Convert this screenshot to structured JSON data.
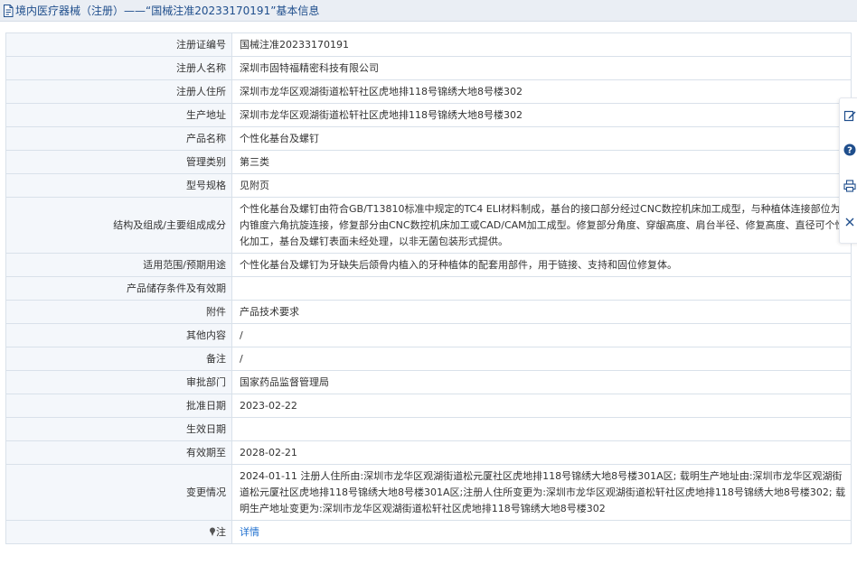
{
  "header": {
    "title": "境内医疗器械（注册）——“国械注准20233170191”基本信息"
  },
  "rows": [
    {
      "label": "注册证编号",
      "value": "国械注准20233170191"
    },
    {
      "label": "注册人名称",
      "value": "深圳市固特福精密科技有限公司"
    },
    {
      "label": "注册人住所",
      "value": "深圳市龙华区观湖街道松轩社区虎地排118号锦绣大地8号楼302"
    },
    {
      "label": "生产地址",
      "value": "深圳市龙华区观湖街道松轩社区虎地排118号锦绣大地8号楼302"
    },
    {
      "label": "产品名称",
      "value": "个性化基台及螺钉"
    },
    {
      "label": "管理类别",
      "value": "第三类"
    },
    {
      "label": "型号规格",
      "value": "见附页"
    },
    {
      "label": "结构及组成/主要组成成分",
      "value": "个性化基台及螺钉由符合GB/T13810标准中规定的TC4 ELI材料制成，基台的接口部分经过CNC数控机床加工成型，与种植体连接部位为内锥度六角抗旋连接，修复部分由CNC数控机床加工或CAD/CAM加工成型。修复部分角度、穿龈高度、肩台半径、修复高度、直径可个性化加工，基台及螺钉表面未经处理，以非无菌包装形式提供。"
    },
    {
      "label": "适用范围/预期用途",
      "value": "个性化基台及螺钉为牙缺失后颌骨内植入的牙种植体的配套用部件，用于链接、支持和固位修复体。"
    },
    {
      "label": "产品储存条件及有效期",
      "value": ""
    },
    {
      "label": "附件",
      "value": "产品技术要求"
    },
    {
      "label": "其他内容",
      "value": "/"
    },
    {
      "label": "备注",
      "value": "/"
    },
    {
      "label": "审批部门",
      "value": "国家药品监督管理局"
    },
    {
      "label": "批准日期",
      "value": "2023-02-22"
    },
    {
      "label": "生效日期",
      "value": ""
    },
    {
      "label": "有效期至",
      "value": "2028-02-21"
    },
    {
      "label": "变更情况",
      "value": "2024-01-11 注册人住所由:深圳市龙华区观湖街道松元厦社区虎地排118号锦绣大地8号楼301A区; 载明生产地址由:深圳市龙华区观湖街道松元厦社区虎地排118号锦绣大地8号楼301A区;注册人住所变更为:深圳市龙华区观湖街道松轩社区虎地排118号锦绣大地8号楼302; 载明生产地址变更为:深圳市龙华区观湖街道松轩社区虎地排118号锦绣大地8号楼302"
    }
  ],
  "note_row": {
    "label": "注",
    "link": "详情"
  },
  "toolbar": {
    "icons": [
      "edit-icon",
      "help-icon",
      "print-icon",
      "close-icon"
    ]
  },
  "colors": {
    "header_text": "#1f4e8c",
    "link": "#1e6fcf",
    "label_bg": "#f4f7fb",
    "border": "#d9e1ea"
  }
}
